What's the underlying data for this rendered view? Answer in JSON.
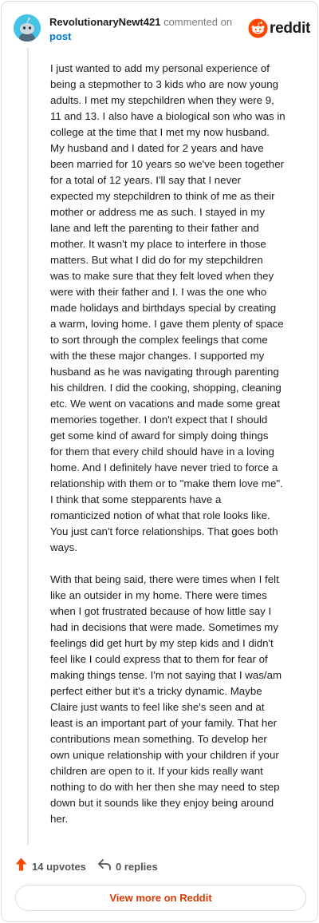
{
  "comment": {
    "username": "RevolutionaryNewt421",
    "action": "commented on",
    "target": "post",
    "paragraphs": [
      "I just wanted to add my personal experience of\nbeing a stepmother to 3 kids who are now young\nadults. I met my stepchildren when they were 9,\n11 and 13. I also have a biological son who was in\ncollege at the time that I met my now husband.\nMy husband and I dated for 2 years and have\nbeen married for 10 years so we've been together\nfor a total of 12 years. I'll say that I never\nexpected my stepchildren to think of me as their\nmother or address me as such. I stayed in my\nlane and left the parenting to their father and\nmother. It wasn't my place to interfere in those\nmatters. But what I did do for my stepchildren\nwas to make sure that they felt loved when they\nwere with their father and I. I was the one who\nmade holidays and birthdays special by creating\na warm, loving home. I gave them plenty of space\nto sort through the complex feelings that come\nwith the these major changes. I supported my\nhusband as he was navigating through parenting\nhis children. I did the cooking, shopping, cleaning\netc. We went on vacations and made some great\nmemories together. I don't expect that I should\nget some kind of award for simply doing things\nfor them that every child should have in a loving\nhome. And I definitely have never tried to force a\nrelationship with them or to \"make them love me\".\nI think that some stepparents have a\nromanticized notion of what that role looks like.\nYou just can't force relationships. That goes both\nways.",
      "With that being said, there were times when I felt\nlike an outsider in my home. There were times\nwhen I got frustrated because of how little say I\nhad in decisions that were made. Sometimes my\nfeelings did get hurt by my step kids and I didn't\nfeel like I could express that to them for fear of\nmaking things tense. I'm not saying that I was/am\nperfect either but it's a tricky dynamic. Maybe\nClaire just wants to feel like she's seen and at\nleast is an important part of your family. That her\ncontributions mean something. To develop her\nown unique relationship with your children if your\nchildren are open to it. If your kids really want\nnothing to do with her then she may need to step\ndown but it sounds like they enjoy being around\nher."
    ],
    "upvotes_label": "14 upvotes",
    "replies_label": "0 replies"
  },
  "brand": {
    "name": "reddit",
    "color": "#ff4500"
  },
  "view_more_label": "View more on Reddit",
  "icons": {
    "avatar": "snoo-avatar-icon",
    "upvote": "upvote-arrow-icon",
    "reply": "reply-arrow-icon",
    "logo": "reddit-logo-icon"
  }
}
